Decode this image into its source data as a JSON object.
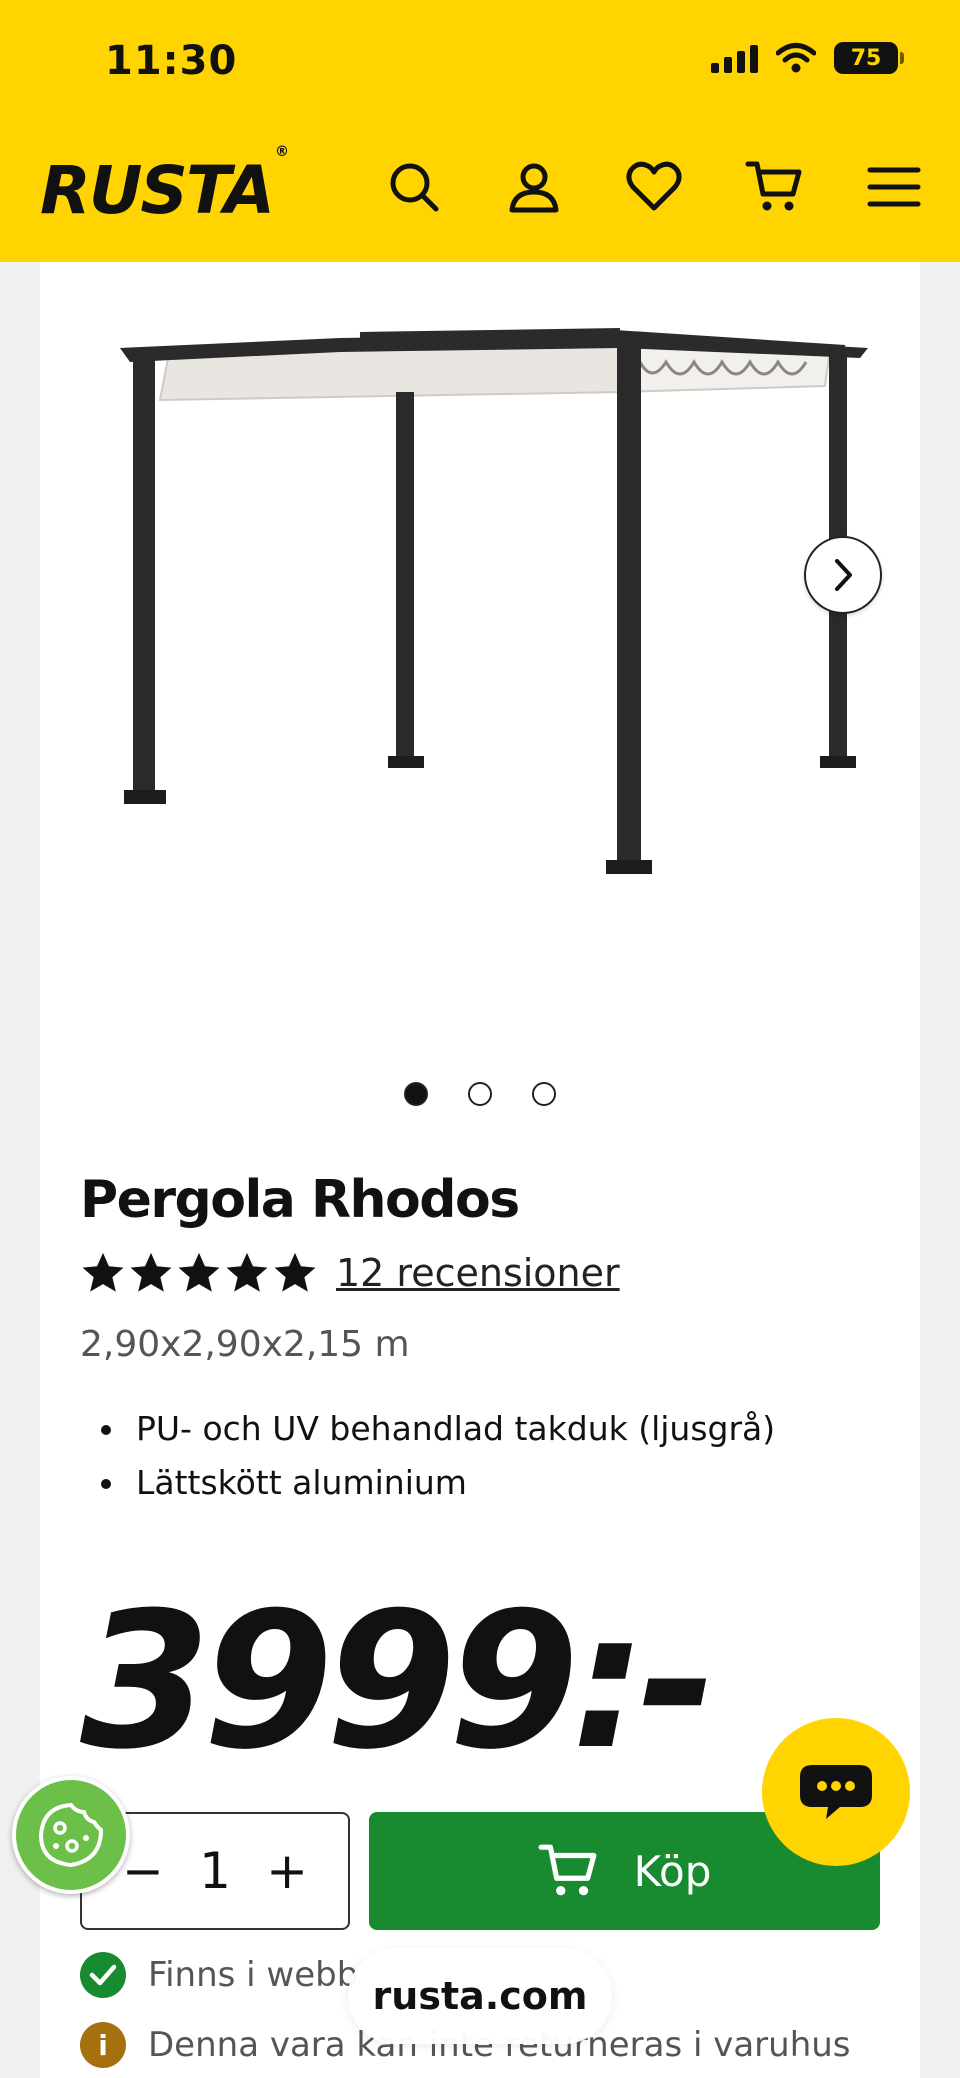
{
  "status_bar": {
    "time": "11:30",
    "battery": "75"
  },
  "header": {
    "logo": "RUSTA",
    "logo_mark": "®",
    "icons": [
      "search-icon",
      "account-icon",
      "heart-icon",
      "cart-icon",
      "menu-icon"
    ],
    "background": "#ffd400"
  },
  "gallery": {
    "slide_count": 3,
    "active_slide": 1
  },
  "product": {
    "title": "Pergola Rhodos",
    "rating": 5,
    "reviews_label": "12 recensioner",
    "dimensions": "2,90x2,90x2,15 m",
    "features": [
      "PU- och UV behandlad takduk (ljusgrå)",
      "Lättskött aluminium"
    ],
    "price": "3999:-"
  },
  "purchase": {
    "quantity": "1",
    "minus": "−",
    "plus": "+",
    "buy_label": "Köp",
    "buy_color": "#188a2f"
  },
  "availability": {
    "stock_text": "Finns i webb",
    "return_text": "Denna vara kan inte returneras i varuhus",
    "info_mark": "i"
  },
  "browser": {
    "url": "rusta.com"
  }
}
